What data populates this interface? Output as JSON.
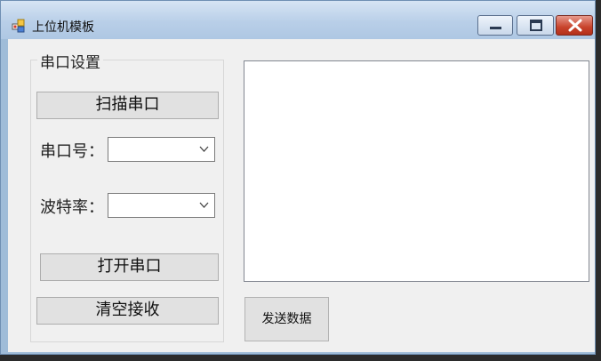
{
  "window": {
    "title": "上位机模板",
    "controls": [
      "minimize",
      "maximize",
      "close"
    ]
  },
  "serial_group": {
    "title": "串口设置",
    "scan_button": "扫描串口",
    "port_label": "串口号：",
    "port_value": "",
    "baud_label": "波特率：",
    "baud_value": "",
    "open_button": "打开串口",
    "clear_button": "清空接收"
  },
  "receive_box": {
    "value": ""
  },
  "send_button": "发送数据"
}
